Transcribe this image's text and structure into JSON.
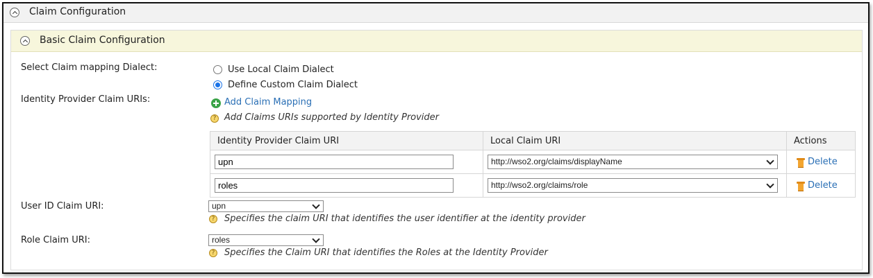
{
  "section": {
    "title": "Claim Configuration"
  },
  "subsection": {
    "title": "Basic Claim Configuration"
  },
  "dialect": {
    "label": "Select Claim mapping Dialect:",
    "options": [
      {
        "label": "Use Local Claim Dialect",
        "checked": false
      },
      {
        "label": "Define Custom Claim Dialect",
        "checked": true
      }
    ]
  },
  "idp_claims": {
    "label": "Identity Provider Claim URIs:",
    "add_link": "Add Claim Mapping",
    "hint": "Add Claims URIs supported by Identity Provider",
    "columns": [
      "Identity Provider Claim URI",
      "Local Claim URI",
      "Actions"
    ],
    "rows": [
      {
        "idp_uri": "upn",
        "local_uri": "http://wso2.org/claims/displayName",
        "action": "Delete"
      },
      {
        "idp_uri": "roles",
        "local_uri": "http://wso2.org/claims/role",
        "action": "Delete"
      }
    ]
  },
  "user_id_claim": {
    "label": "User ID Claim URI:",
    "selected": "upn",
    "hint": "Specifies the claim URI that identifies the user identifier at the identity provider"
  },
  "role_claim": {
    "label": "Role Claim URI:",
    "selected": "roles",
    "hint": "Specifies the Claim URI that identifies the Roles at the Identity Provider"
  },
  "colors": {
    "link": "#2a6fb5",
    "subheader_bg": "#f7f6dc",
    "radio_accent": "#1a73e8",
    "add_icon": "#3aa347"
  }
}
